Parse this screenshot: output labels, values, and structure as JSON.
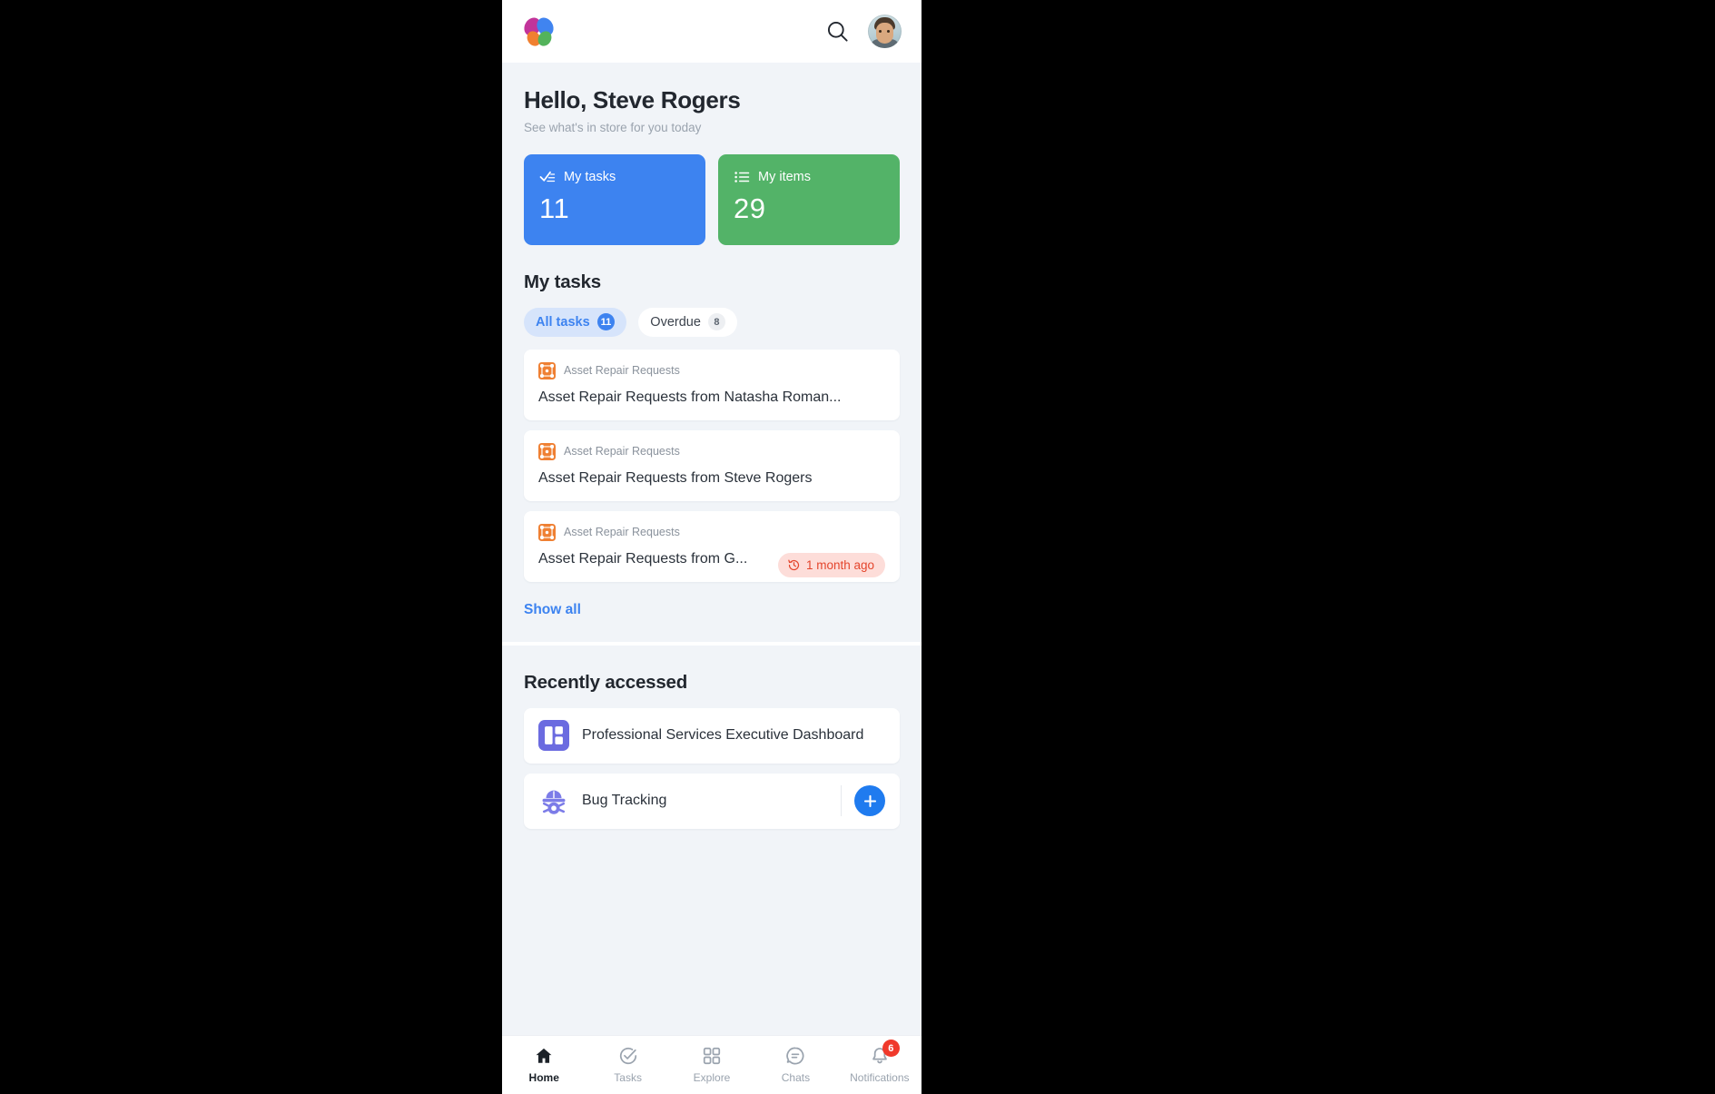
{
  "colors": {
    "accent_blue": "#3d83f0",
    "accent_green": "#53b368",
    "overdue_red": "#e4452c",
    "badge_red": "#f0392b",
    "process_orange": "#ef8033",
    "dashboard_purple": "#6b6be0",
    "app_bg": "#f1f4f8"
  },
  "header": {
    "logo_name": "kissflow-logo",
    "search_icon": "search-icon",
    "avatar_alt": "user-avatar"
  },
  "greeting": {
    "title": "Hello, Steve Rogers",
    "subtitle": "See what's in store for you today"
  },
  "stats": [
    {
      "icon": "checklist-icon",
      "label": "My tasks",
      "value": "11",
      "color": "#3d83f0"
    },
    {
      "icon": "bullet-list-icon",
      "label": "My items",
      "value": "29",
      "color": "#53b368"
    }
  ],
  "my_tasks": {
    "section_title": "My tasks",
    "chips": [
      {
        "label": "All tasks",
        "count": "11",
        "active": true
      },
      {
        "label": "Overdue",
        "count": "8",
        "active": false
      }
    ],
    "cards": [
      {
        "process_icon": "process-icon",
        "process": "Asset Repair Requests",
        "title": "Asset Repair Requests from Natasha Roman...",
        "overdue": null
      },
      {
        "process_icon": "process-icon",
        "process": "Asset Repair Requests",
        "title": "Asset Repair Requests from Steve Rogers",
        "overdue": null
      },
      {
        "process_icon": "process-icon",
        "process": "Asset Repair Requests",
        "title": "Asset Repair Requests from G...",
        "overdue": "1 month ago"
      }
    ],
    "show_all_label": "Show all"
  },
  "recently_accessed": {
    "section_title": "Recently accessed",
    "items": [
      {
        "icon": "dashboard-icon",
        "name": "Professional Services Executive Dashboard",
        "has_add": false
      },
      {
        "icon": "bug-icon",
        "name": "Bug Tracking",
        "has_add": true
      }
    ]
  },
  "bottom_nav": [
    {
      "icon": "home-icon",
      "label": "Home",
      "active": true,
      "badge": null
    },
    {
      "icon": "check-circle-icon",
      "label": "Tasks",
      "active": false,
      "badge": null
    },
    {
      "icon": "grid-icon",
      "label": "Explore",
      "active": false,
      "badge": null
    },
    {
      "icon": "chat-icon",
      "label": "Chats",
      "active": false,
      "badge": null
    },
    {
      "icon": "bell-icon",
      "label": "Notifications",
      "active": false,
      "badge": "6"
    }
  ]
}
